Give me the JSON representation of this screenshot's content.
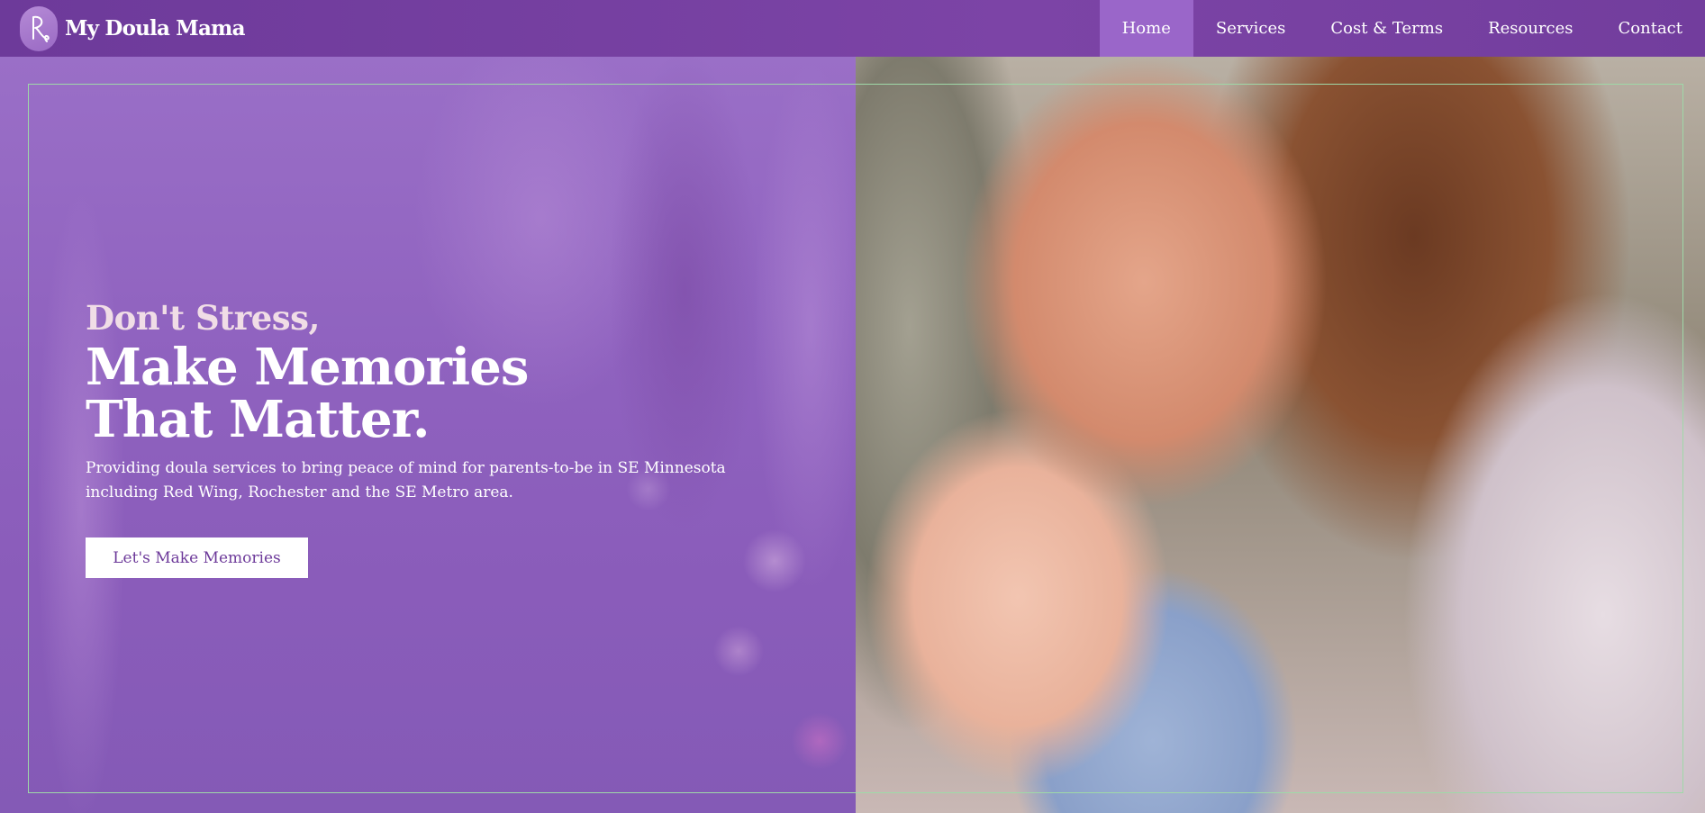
{
  "nav": {
    "brand": {
      "name": "My Doula Mama",
      "logo_icon": "doula-monogram-logo"
    },
    "menu": [
      {
        "label": "Home",
        "active": true
      },
      {
        "label": "Services",
        "active": false
      },
      {
        "label": "Cost & Terms",
        "active": false
      },
      {
        "label": "Resources",
        "active": false
      },
      {
        "label": "Contact",
        "active": false
      }
    ]
  },
  "hero": {
    "kicker": "Don't Stress,",
    "headline": "Make Memories That Matter.",
    "subtext": "Providing doula services to bring peace of mind for parents-to-be in SE Minnesota including Red Wing, Rochester and the SE Metro area.",
    "cta_label": "Let's Make Memories",
    "image": "mother-holding-baby-photo"
  },
  "colors": {
    "nav_bg": "#7443a3",
    "nav_active": "#9a66c9",
    "hero_overlay": "#8f62bf",
    "frame_line": "#9fd9a8",
    "cta_text": "#6d3a9a"
  }
}
